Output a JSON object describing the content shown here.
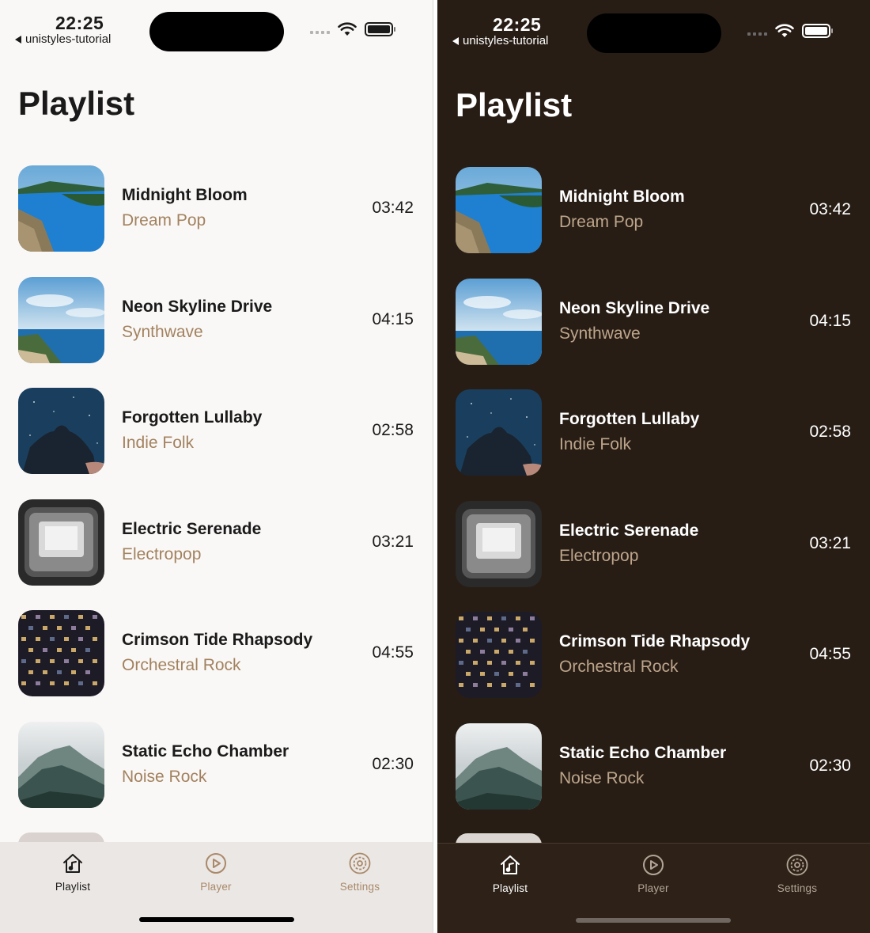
{
  "status": {
    "time": "22:25",
    "back_app": "unistyles-tutorial"
  },
  "screen_title": "Playlist",
  "songs": [
    {
      "title": "Midnight Bloom",
      "genre": "Dream Pop",
      "duration": "03:42",
      "art": "fjord-landscape"
    },
    {
      "title": "Neon Skyline Drive",
      "genre": "Synthwave",
      "duration": "04:15",
      "art": "coastal-cliff-sky"
    },
    {
      "title": "Forgotten Lullaby",
      "genre": "Indie Folk",
      "duration": "02:58",
      "art": "night-sky-silhouette"
    },
    {
      "title": "Electric Serenade",
      "genre": "Electropop",
      "duration": "03:21",
      "art": "monochrome-screen"
    },
    {
      "title": "Crimson Tide Rhapsody",
      "genre": "Orchestral Rock",
      "duration": "04:55",
      "art": "city-building-windows"
    },
    {
      "title": "Static Echo Chamber",
      "genre": "Noise Rock",
      "duration": "02:30",
      "art": "misty-mountain"
    }
  ],
  "tabs": [
    {
      "label": "Playlist",
      "icon": "home-music-icon",
      "active": true
    },
    {
      "label": "Player",
      "icon": "play-circle-icon",
      "active": false
    },
    {
      "label": "Settings",
      "icon": "gear-circle-icon",
      "active": false
    }
  ],
  "themes": {
    "light": {
      "background": "#faf8f6",
      "text": "#1a1a1a",
      "accent": "#a2825f",
      "tabbar": "#ebe7e4"
    },
    "dark": {
      "background": "#271d15",
      "text": "#ffffff",
      "accent": "#bda58b",
      "tabbar": "#2e2218"
    }
  }
}
